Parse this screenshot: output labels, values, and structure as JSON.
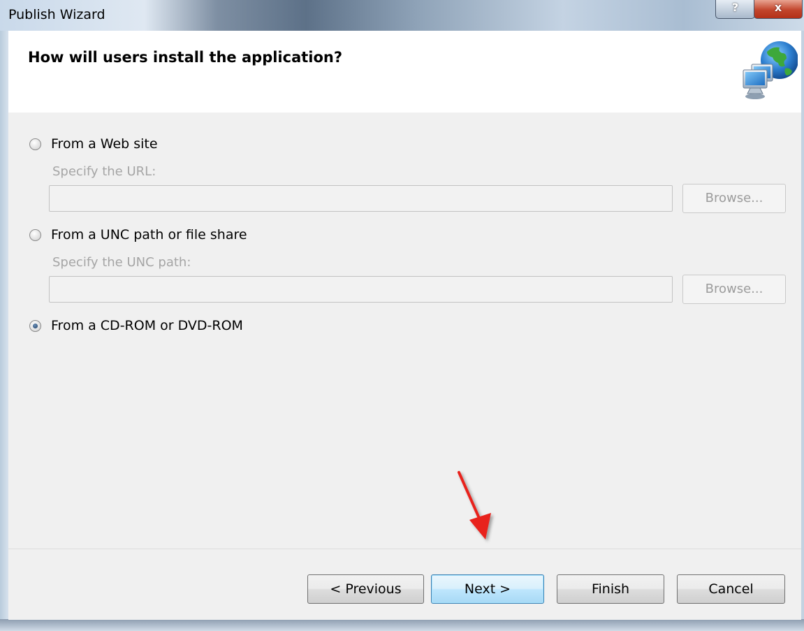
{
  "window": {
    "title": "Publish Wizard",
    "help_label": "?",
    "close_label": "x"
  },
  "header": {
    "heading": "How will users install the application?",
    "icon": "globe-computer-icon"
  },
  "options": [
    {
      "label": "From a Web site",
      "selected": false,
      "sub_label": "Specify the URL:",
      "input_value": "",
      "browse_label": "Browse..."
    },
    {
      "label": "From a UNC path or file share",
      "selected": false,
      "sub_label": "Specify the UNC path:",
      "input_value": "",
      "browse_label": "Browse..."
    },
    {
      "label": "From a CD-ROM or DVD-ROM",
      "selected": true
    }
  ],
  "footer": {
    "previous_label": "< Previous",
    "next_label": "Next >",
    "finish_label": "Finish",
    "cancel_label": "Cancel"
  },
  "annotation": {
    "icon": "red-arrow-icon",
    "color": "#e8231b"
  }
}
